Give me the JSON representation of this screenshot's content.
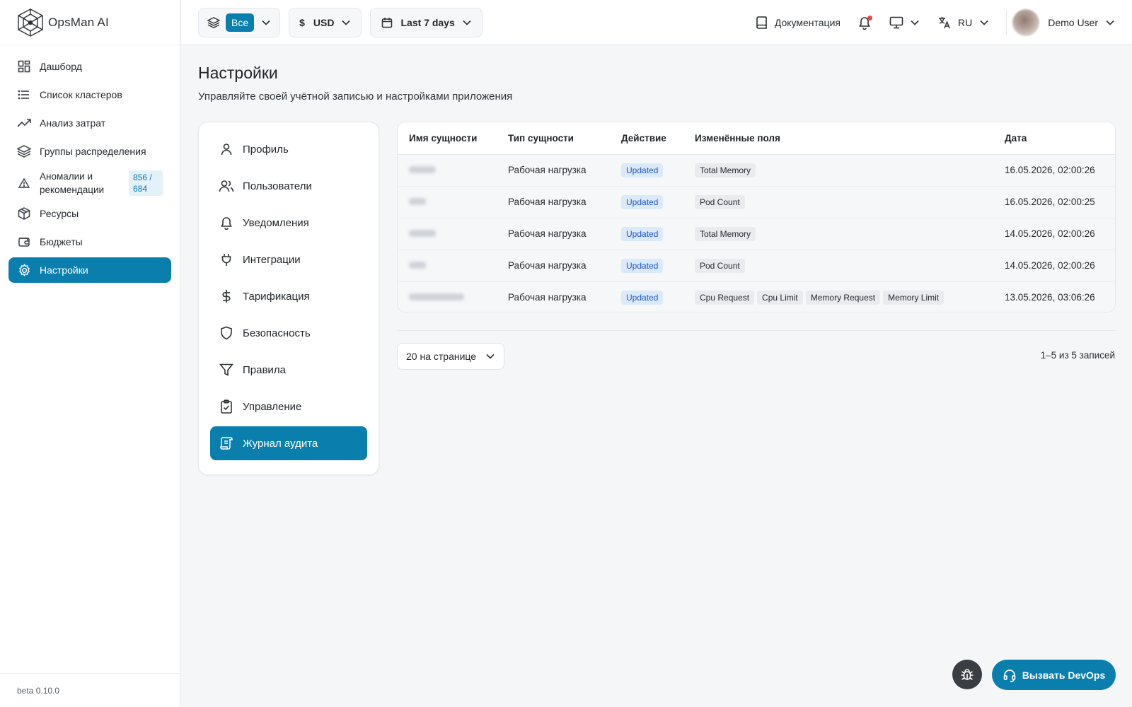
{
  "brand": {
    "name": "OpsMan AI"
  },
  "sidebar": {
    "items": [
      {
        "label": "Дашборд",
        "icon": "dashboard-icon"
      },
      {
        "label": "Список кластеров",
        "icon": "list-icon"
      },
      {
        "label": "Анализ затрат",
        "icon": "trend-icon"
      },
      {
        "label": "Группы распределения",
        "icon": "layers-icon"
      },
      {
        "label": "Аномалии и рекомендации",
        "icon": "warning-icon",
        "badge": "856 / 684"
      },
      {
        "label": "Ресурсы",
        "icon": "box-icon"
      },
      {
        "label": "Бюджеты",
        "icon": "wallet-icon"
      },
      {
        "label": "Настройки",
        "icon": "gear-icon",
        "active": true
      }
    ],
    "version": "beta 0.10.0"
  },
  "topbar": {
    "scope_label": "Все",
    "currency_symbol": "$",
    "currency": "USD",
    "date_range": "Last 7 days",
    "docs": "Документация",
    "language": "RU",
    "user_name": "Demo User",
    "notification_dot_color": "#e5484d"
  },
  "page": {
    "title": "Настройки",
    "subtitle": "Управляйте своей учётной записью и настройками приложения"
  },
  "settings_menu": [
    {
      "label": "Профиль",
      "icon": "user-icon"
    },
    {
      "label": "Пользователи",
      "icon": "users-icon"
    },
    {
      "label": "Уведомления",
      "icon": "bell-icon"
    },
    {
      "label": "Интеграции",
      "icon": "plug-icon"
    },
    {
      "label": "Тарификация",
      "icon": "dollar-icon"
    },
    {
      "label": "Безопасность",
      "icon": "shield-icon"
    },
    {
      "label": "Правила",
      "icon": "filter-icon"
    },
    {
      "label": "Управление",
      "icon": "clipboard-check-icon"
    },
    {
      "label": "Журнал аудита",
      "icon": "scroll-icon",
      "active": true
    }
  ],
  "audit_table": {
    "headers": [
      "Имя сущности",
      "Тип сущности",
      "Действие",
      "Изменённые поля",
      "Дата"
    ],
    "rows": [
      {
        "type": "Рабочая нагрузка",
        "action": "Updated",
        "fields": [
          "Total Memory"
        ],
        "date": "16.05.2026, 02:00:26"
      },
      {
        "type": "Рабочая нагрузка",
        "action": "Updated",
        "fields": [
          "Pod Count"
        ],
        "date": "16.05.2026, 02:00:25"
      },
      {
        "type": "Рабочая нагрузка",
        "action": "Updated",
        "fields": [
          "Total Memory"
        ],
        "date": "14.05.2026, 02:00:26"
      },
      {
        "type": "Рабочая нагрузка",
        "action": "Updated",
        "fields": [
          "Pod Count"
        ],
        "date": "14.05.2026, 02:00:26"
      },
      {
        "type": "Рабочая нагрузка",
        "action": "Updated",
        "fields": [
          "Cpu Request",
          "Cpu Limit",
          "Memory Request",
          "Memory Limit"
        ],
        "date": "13.05.2026, 03:06:26"
      }
    ]
  },
  "pagination": {
    "page_size": "20 на странице",
    "records": "1–5 из 5 записей"
  },
  "floating": {
    "devops_label": "Вызвать DevOps"
  },
  "colors": {
    "accent": "#0a7fae",
    "badge_bg": "#dbeafa",
    "badge_text": "#1e56c8"
  }
}
